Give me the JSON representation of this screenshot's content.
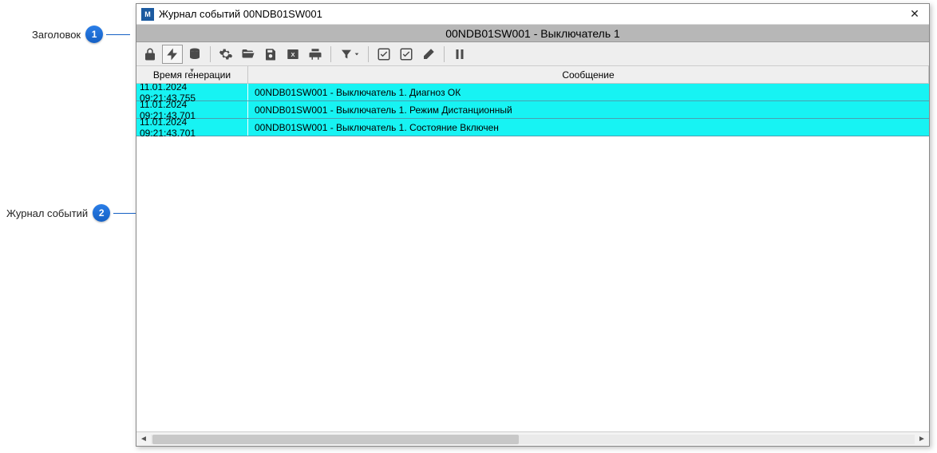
{
  "annotations": {
    "a1": {
      "label": "Заголовок",
      "num": "1"
    },
    "a2": {
      "label": "Журнал событий",
      "num": "2"
    }
  },
  "window": {
    "app_icon_text": "M",
    "title": "Журнал событий 00NDB01SW001",
    "close_glyph": "✕"
  },
  "header": {
    "text": "00NDB01SW001 - Выключатель 1"
  },
  "toolbar": {
    "icons": {
      "lock": "lock-icon",
      "bolt": "bolt-icon",
      "db": "database-icon",
      "gear": "gear-icon",
      "folder": "folder-open-icon",
      "save": "save-icon",
      "excel": "excel-export-icon",
      "print": "print-icon",
      "filter": "filter-icon",
      "check1": "check-square-icon",
      "check2": "check-square-icon",
      "eraser": "eraser-icon",
      "pause": "pause-icon"
    }
  },
  "columns": {
    "time": "Время генерации",
    "message": "Сообщение"
  },
  "rows": [
    {
      "time": "11.01.2024 09:21:43.755",
      "msg": "00NDB01SW001 - Выключатель 1. Диагноз ОК"
    },
    {
      "time": "11.01.2024 09:21:43.701",
      "msg": "00NDB01SW001 - Выключатель 1. Режим Дистанционный"
    },
    {
      "time": "11.01.2024 09:21:43.701",
      "msg": "00NDB01SW001 - Выключатель 1. Состояние Включен"
    }
  ],
  "scroll": {
    "left_glyph": "◄",
    "right_glyph": "►"
  }
}
